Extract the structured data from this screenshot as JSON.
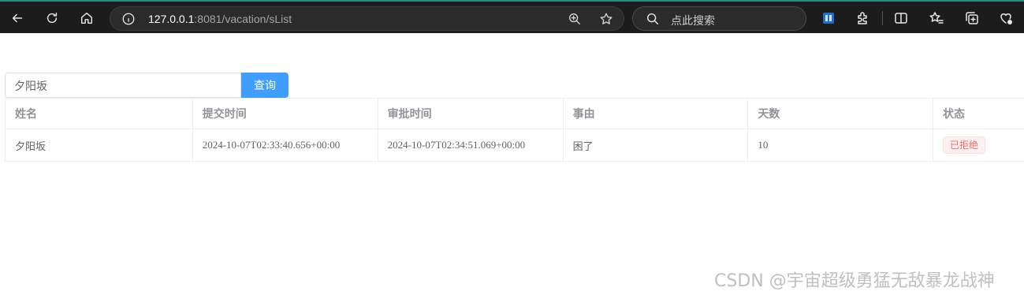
{
  "browser": {
    "url_host": "127.0.0.1",
    "url_path": ":8081/vacation/sList",
    "search_placeholder": "点此搜索"
  },
  "query": {
    "input_value": "夕阳坂",
    "button_label": "查询"
  },
  "table": {
    "headers": [
      "姓名",
      "提交时间",
      "审批时间",
      "事由",
      "天数",
      "状态"
    ],
    "rows": [
      {
        "name": "夕阳坂",
        "submit_time": "2024-10-07T02:33:40.656+00:00",
        "approve_time": "2024-10-07T02:34:51.069+00:00",
        "reason": "困了",
        "days": "10",
        "status": "已拒绝"
      }
    ]
  },
  "watermark": "CSDN @宇宙超级勇猛无敌暴龙战神",
  "colors": {
    "primary": "#409eff",
    "danger": "#f56c6c",
    "chrome_bg": "#1c1c1c"
  }
}
